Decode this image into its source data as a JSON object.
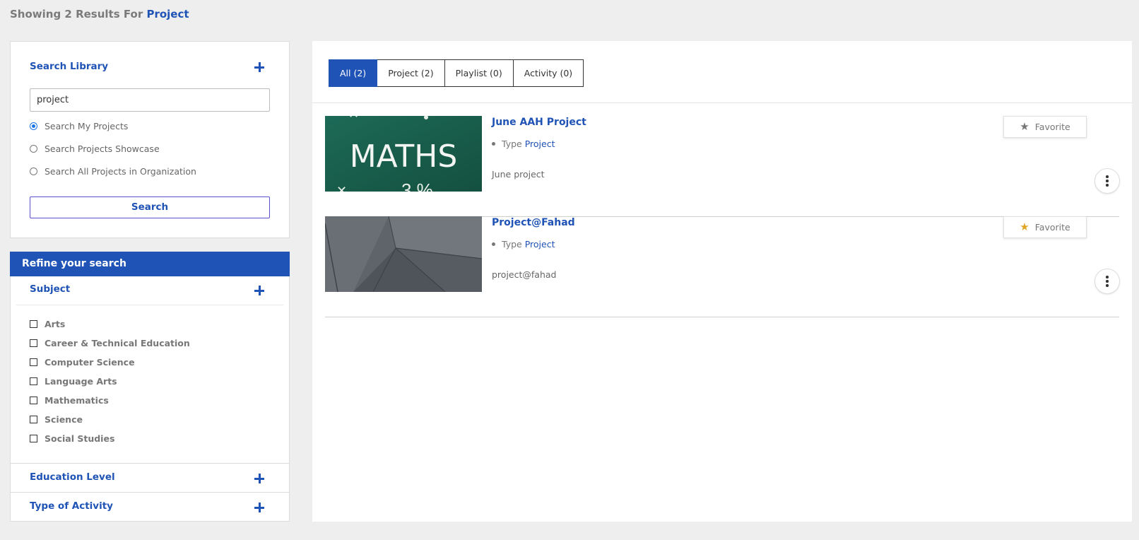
{
  "header": {
    "prefix": "Showing 2 Results For",
    "query": "Project"
  },
  "search_library": {
    "title": "Search Library",
    "input_value": "project",
    "radio_options": [
      {
        "label": "Search My Projects",
        "checked": true
      },
      {
        "label": "Search Projects Showcase",
        "checked": false
      },
      {
        "label": "Search All Projects in Organization",
        "checked": false
      }
    ],
    "search_button": "Search"
  },
  "refine": {
    "title": "Refine your search",
    "subject_title": "Subject",
    "subjects": [
      "Arts",
      "Career & Technical Education",
      "Computer Science",
      "Language Arts",
      "Mathematics",
      "Science",
      "Social Studies"
    ],
    "education_level_title": "Education Level",
    "type_of_activity_title": "Type of Activity"
  },
  "tabs": [
    {
      "label": "All (2)",
      "active": true
    },
    {
      "label": "Project (2)",
      "active": false
    },
    {
      "label": "Playlist (0)",
      "active": false
    },
    {
      "label": "Activity (0)",
      "active": false
    }
  ],
  "results": [
    {
      "title": "June AAH Project",
      "type_label": "Type",
      "type_value": "Project",
      "description": "June project",
      "favorite_label": "Favorite",
      "favorited": false,
      "thumb_text": "MATHS"
    },
    {
      "title": "Project@Fahad",
      "type_label": "Type",
      "type_value": "Project",
      "description": "project@fahad",
      "favorite_label": "Favorite",
      "favorited": true
    }
  ],
  "colors": {
    "brand": "#1f53b5",
    "star_gray": "#777777",
    "star_gold": "#e0a526"
  }
}
